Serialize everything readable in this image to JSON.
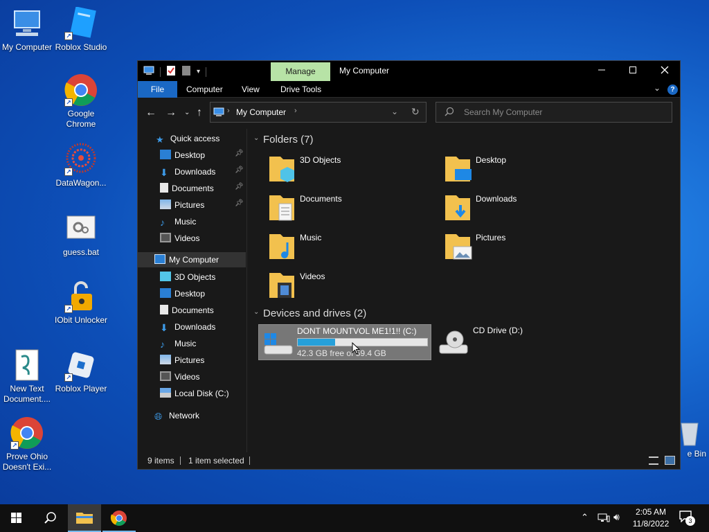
{
  "desktop": {
    "icons": [
      {
        "label": "My Computer"
      },
      {
        "label": "Roblox Studio"
      },
      {
        "label": "Google Chrome"
      },
      {
        "label": "DataWagon..."
      },
      {
        "label": "guess.bat"
      },
      {
        "label": "IObit Unlocker"
      },
      {
        "label": "New Text Document...."
      },
      {
        "label": "Roblox Player"
      },
      {
        "label": "Prove Ohio Doesn't Exi..."
      },
      {
        "label": "e Bin"
      }
    ]
  },
  "window": {
    "title": "My Computer",
    "manage_tab": "Manage",
    "ribbon_tabs": [
      "File",
      "Computer",
      "View",
      "Drive Tools"
    ],
    "breadcrumb": "My Computer",
    "search_placeholder": "Search My Computer",
    "nav": {
      "quick_access": "Quick access",
      "quick_items": [
        "Desktop",
        "Downloads",
        "Documents",
        "Pictures",
        "Music",
        "Videos"
      ],
      "my_computer": "My Computer",
      "computer_items": [
        "3D Objects",
        "Desktop",
        "Documents",
        "Downloads",
        "Music",
        "Pictures",
        "Videos",
        "Local Disk (C:)"
      ],
      "network": "Network"
    },
    "folders_header": "Folders (7)",
    "folders": [
      "3D Objects",
      "Desktop",
      "Documents",
      "Downloads",
      "Music",
      "Pictures",
      "Videos"
    ],
    "drives_header": "Devices and drives (2)",
    "drives": [
      {
        "name": "DONT MOUNTVOL ME1!1!! (C:)",
        "free_text": "42.3 GB free of 59.4 GB",
        "used_fraction": 0.29
      },
      {
        "name": "CD Drive (D:)"
      }
    ],
    "status": {
      "items": "9 items",
      "selected": "1 item selected"
    }
  },
  "taskbar": {
    "time": "2:05 AM",
    "date": "11/8/2022",
    "notifications": "3"
  },
  "colors": {
    "accent": "#1a68c4",
    "manage": "#b7e3a6",
    "folder": "#f2c14e"
  }
}
